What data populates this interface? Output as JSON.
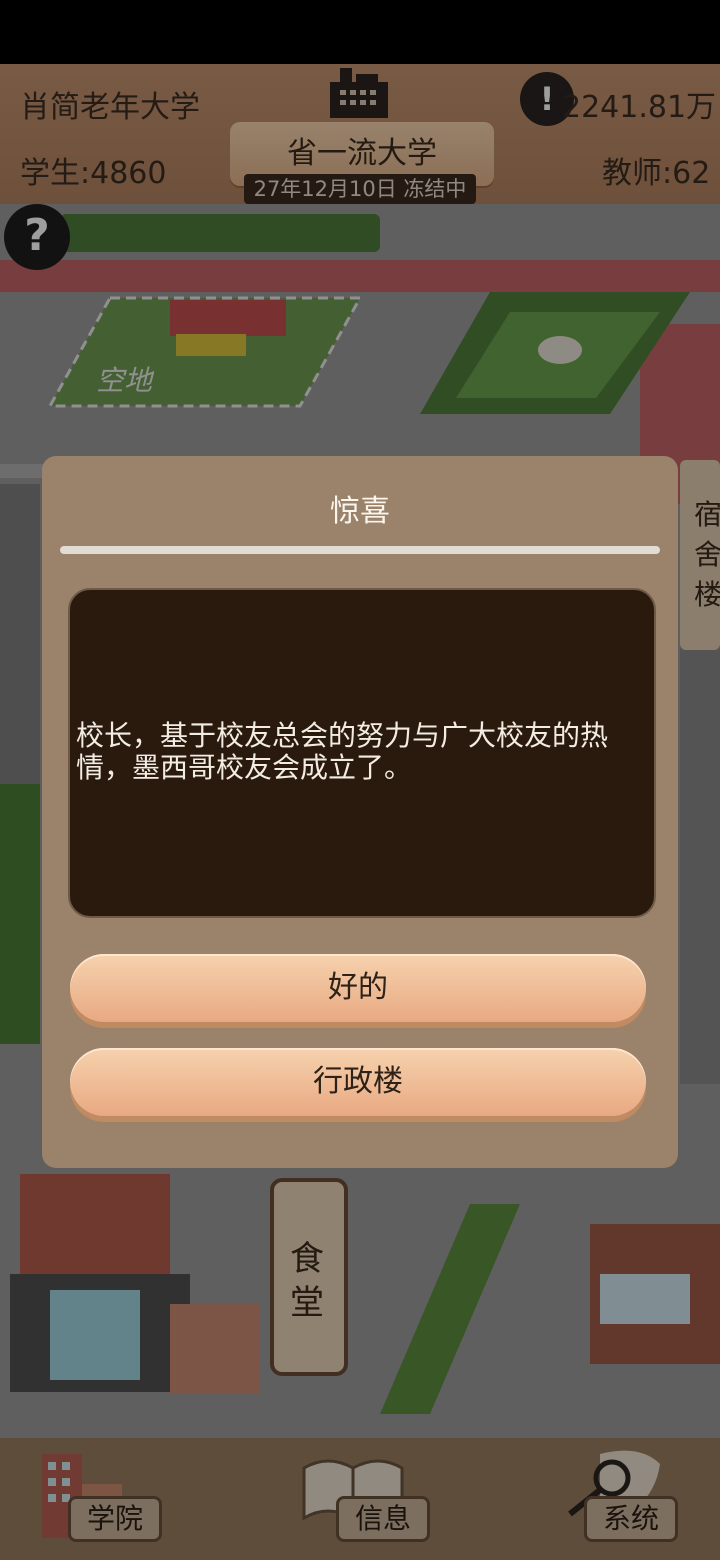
{
  "header": {
    "school_name": "肖简老年大学",
    "money": "2241.81万",
    "students": "学生:4860",
    "teachers": "教师:62",
    "rank_title": "省一流大学",
    "date_status": "27年12月10日 冻结中",
    "alert_symbol": "!",
    "help_symbol": "?"
  },
  "map_labels": {
    "empty_lot": "空地",
    "dorm": "宿舍楼",
    "canteen": "食堂"
  },
  "dialog": {
    "title": "惊喜",
    "message": "校长，基于校友总会的努力与广大校友的热情，墨西哥校友会成立了。",
    "buttons": {
      "ok": "好的",
      "admin_building": "行政楼"
    }
  },
  "bottom_nav": {
    "college": "学院",
    "info": "信息",
    "system": "系统"
  },
  "colors": {
    "dialog_bg": "#9b826b",
    "message_bg": "#2a1a0e",
    "button_gradient_top": "#f6d2ae",
    "button_gradient_bottom": "#e8a982"
  }
}
